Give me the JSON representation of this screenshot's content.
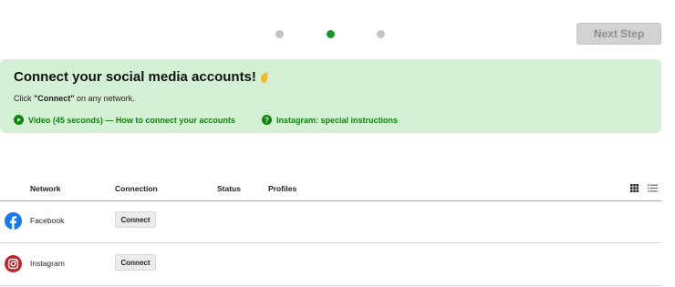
{
  "stepper": {
    "steps": [
      "step-1",
      "step-2",
      "step-3"
    ],
    "active_step": 2
  },
  "header": {
    "next_step_label": "Next Step"
  },
  "banner": {
    "title": "Connect your social media accounts!",
    "subtitle_prefix": "Click ",
    "subtitle_bold": "\"Connect\"",
    "subtitle_suffix": " on any network.",
    "video_link": "Video (45 seconds) — How to connect your accounts",
    "instagram_link": "Instagram: special instructions"
  },
  "table": {
    "headers": {
      "network": "Network",
      "connection": "Connection",
      "status": "Status",
      "profiles": "Profiles"
    },
    "rows": [
      {
        "network": "Facebook",
        "icon": "facebook-icon",
        "action": "Connect"
      },
      {
        "network": "Instagram",
        "icon": "instagram-icon",
        "action": "Connect"
      }
    ]
  },
  "colors": {
    "accent_green": "#169b2b",
    "banner_bg": "#d4f0d4",
    "link_green": "#12820f",
    "facebook_blue": "#1877f2",
    "instagram_red": "#c1272d"
  }
}
